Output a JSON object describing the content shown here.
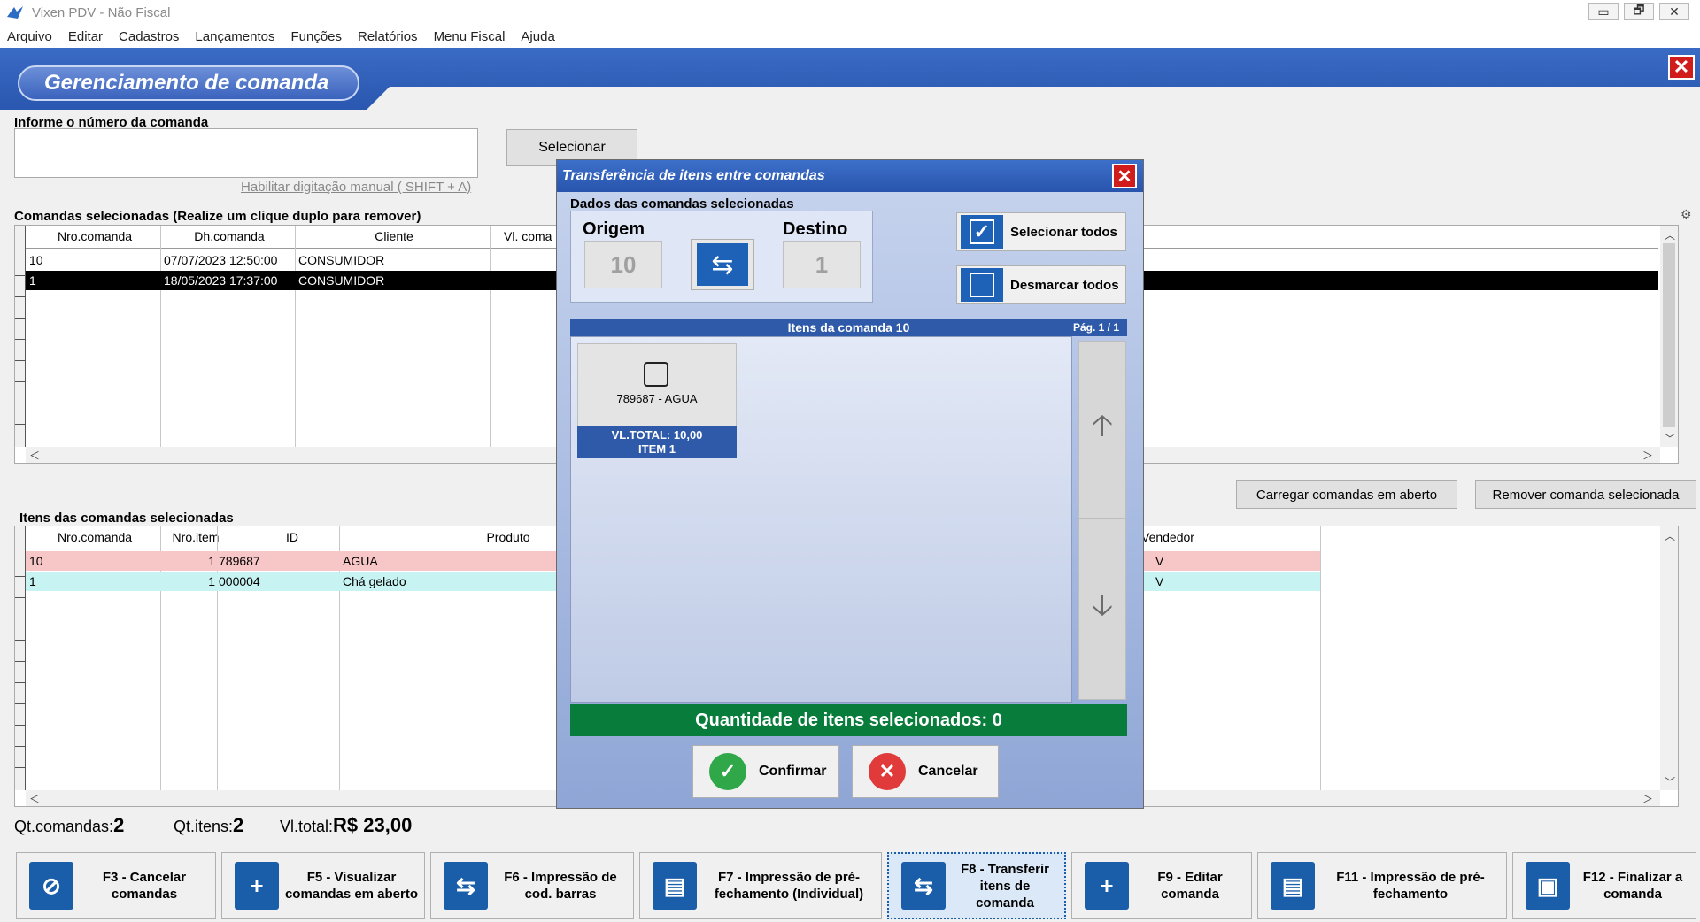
{
  "window": {
    "title": "Vixen PDV - Não Fiscal",
    "controls": {
      "minimize": "▭",
      "restore": "🗗",
      "close": "✕"
    }
  },
  "menu": [
    "Arquivo",
    "Editar",
    "Cadastros",
    "Lançamentos",
    "Funções",
    "Relatórios",
    "Menu Fiscal",
    "Ajuda"
  ],
  "header": {
    "title": "Gerenciamento de comanda",
    "close": "✕"
  },
  "form": {
    "label": "Informe o número da comanda",
    "value": "",
    "select_button": "Selecionar",
    "manual_link": "Habilitar digitação manual ( SHIFT + A)"
  },
  "comandas": {
    "label": "Comandas selecionadas (Realize um clique duplo para remover)",
    "columns": [
      "Nro.comanda",
      "Dh.comanda",
      "Cliente",
      "Vl. coma"
    ],
    "rows": [
      [
        "10",
        "07/07/2023 12:50:00",
        "CONSUMIDOR"
      ],
      [
        "1",
        "18/05/2023 17:37:00",
        "CONSUMIDOR"
      ]
    ]
  },
  "actions": {
    "load_open": "Carregar comandas em aberto",
    "remove_selected": "Remover comanda selecionada"
  },
  "itens": {
    "label": "Itens das comandas selecionadas",
    "columns": [
      "Nro.comanda",
      "Nro.item",
      "ID",
      "Produto",
      "Vendedor"
    ],
    "rows": [
      {
        "comanda": "10",
        "item": "1",
        "id": "789687",
        "produto": "AGUA",
        "vendedor": "V"
      },
      {
        "comanda": "1",
        "item": "1",
        "id": "000004",
        "produto": "Chá gelado",
        "vendedor": "V"
      }
    ]
  },
  "status": {
    "qt_comandas_label": "Qt.comandas:",
    "qt_comandas": "2",
    "qt_itens_label": "Qt.itens:",
    "qt_itens": "2",
    "vl_total_label": "Vl.total:",
    "vl_total": "R$ 23,00"
  },
  "toolbar": [
    {
      "key": "f3",
      "label": "F3 - Cancelar comandas",
      "icon": "document-cancel-icon",
      "glyph": "⊘"
    },
    {
      "key": "f5",
      "label": "F5 - Visualizar comandas em aberto",
      "icon": "document-add-icon",
      "glyph": "+"
    },
    {
      "key": "f6",
      "label": "F6 - Impressão de cod. barras",
      "icon": "document-transfer-icon",
      "glyph": "⇆"
    },
    {
      "key": "f7",
      "label": "F7 - Impressão de pré-fechamento (Individual)",
      "icon": "printer-icon",
      "glyph": "▤"
    },
    {
      "key": "f8",
      "label": "F8 - Transferir itens de comanda",
      "icon": "printer-transfer-icon",
      "glyph": "⇆"
    },
    {
      "key": "f9",
      "label": "F9 - Editar comanda",
      "icon": "document-edit-icon",
      "glyph": "+"
    },
    {
      "key": "f11",
      "label": "F11 - Impressão de pré-fechamento",
      "icon": "printer-icon",
      "glyph": "▤"
    },
    {
      "key": "f12",
      "label": "F12 - Finalizar a comanda",
      "icon": "document-finish-icon",
      "glyph": "▣"
    }
  ],
  "dialog": {
    "title": "Transferência de itens entre comandas",
    "group_label": "Dados das comandas selecionadas",
    "origem_label": "Origem",
    "origem": "10",
    "destino_label": "Destino",
    "destino": "1",
    "select_all": "Selecionar todos",
    "deselect_all": "Desmarcar todos",
    "items_header": "Itens da comanda 10",
    "page": "Pág. 1 / 1",
    "item": {
      "name": "789687 - AGUA",
      "total": "VL.TOTAL: 10,00",
      "number": "ITEM 1"
    },
    "qty_label": "Quantidade de itens selecionados: 0",
    "confirm": "Confirmar",
    "cancel": "Cancelar"
  },
  "colors": {
    "accent": "#2f5aa9",
    "confirm": "#30a84a",
    "cancel": "#e03a3a",
    "qty_bar": "#087d3b",
    "row_pink": "#f7c6c6",
    "row_cyan": "#c8f3f3"
  }
}
